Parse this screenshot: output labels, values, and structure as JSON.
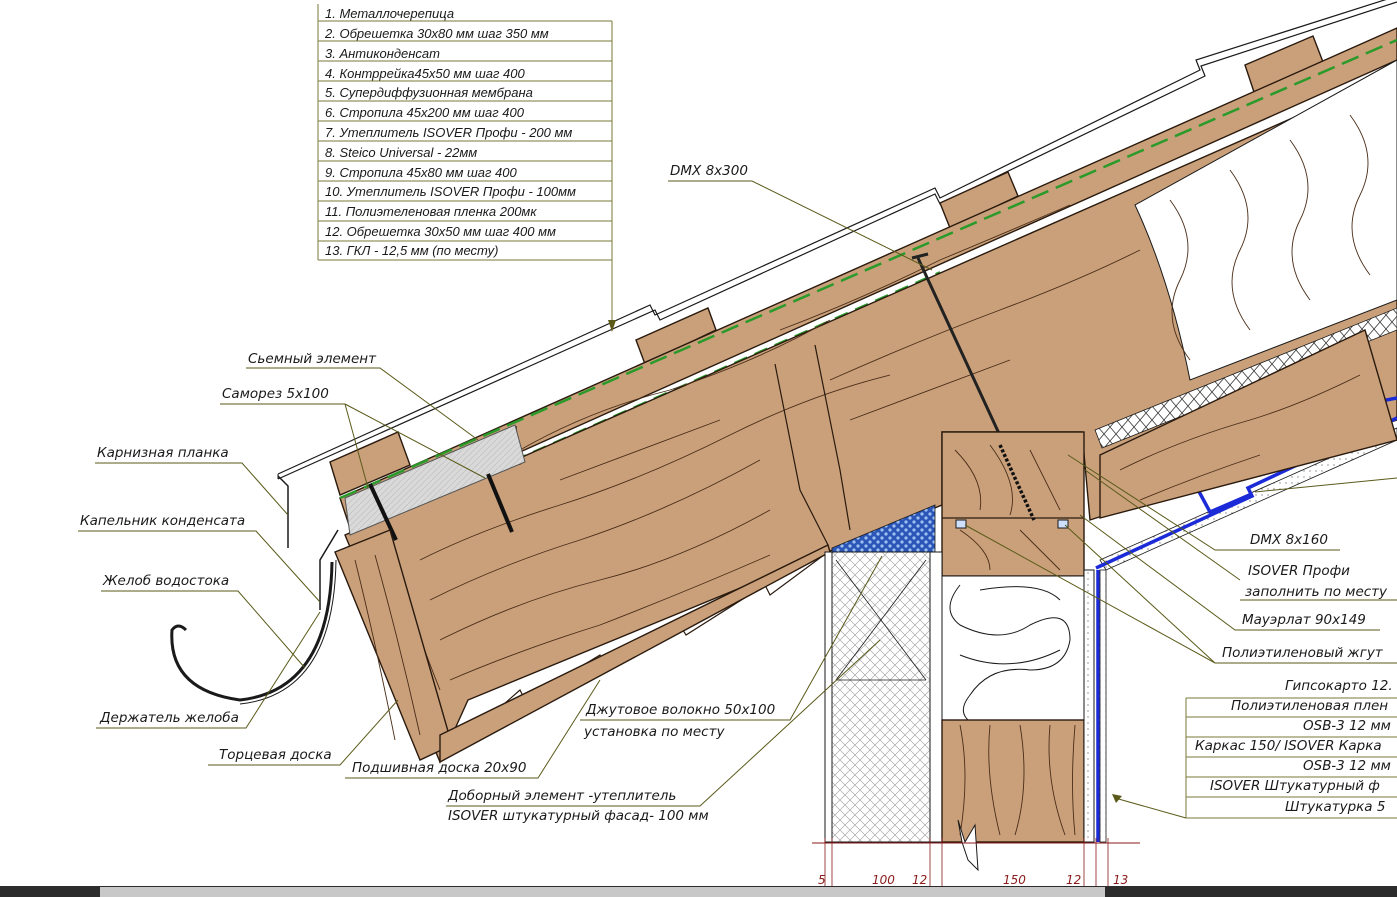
{
  "legend": {
    "items": [
      "1. Металлочерепица",
      "2. Обрешетка 30х80 мм шаг 350 мм",
      "3. Антиконденсат",
      "4. Контррейка45х50 мм шаг 400",
      "5. Супердиффузионная мембрана",
      "6. Стропила 45х200 мм шаг 400",
      "7. Утеплитель ISOVER Профи - 200 мм",
      "8. Steico Universal - 22мм",
      "9. Стропила 45х80 мм шаг 400",
      "10. Утеплитель ISOVER Профи - 100мм",
      "11. Полиэтеленовая пленка 200мк",
      "12. Обрешетка 30х50 мм шаг 400 мм",
      "13. ГКЛ - 12,5 мм (по месту)"
    ]
  },
  "callouts": {
    "dmx300": "DMX 8x300",
    "removable": "Сьемный элемент",
    "screw": "Саморез 5х100",
    "eaves_strip": "Карнизная планка",
    "drip": "Капельник конденсата",
    "gutter": "Желоб водостока",
    "gutter_holder": "Держатель желоба",
    "fascia": "Торцевая доска",
    "soffit": "Подшивная доска 20х90",
    "jute_1": "Джутовое волокно 50х100",
    "jute_2": "установка по месту",
    "extra_1": "Доборный элемент -утеплитель",
    "extra_2": "ISOVER штукатурный фасад- 100 мм",
    "dmx160": "DMX 8x160",
    "isover_1": "ISOVER Профи",
    "isover_2": "заполнить по месту",
    "mauerlat": "Мауэрлат 90х149",
    "pe_cord": "Полиэтиленовый жгут"
  },
  "wall_table": {
    "rows": [
      "Гипсокарто 12.",
      "Полиэтиленовая плен",
      "OSB-3 12 мм",
      "Каркас 150/ ISOVER Карка",
      "OSB-3 12 мм",
      "ISOVER Штукатурный ф",
      "Штукатурка 5"
    ]
  },
  "dimensions": [
    "5",
    "100",
    "12",
    "150",
    "12",
    "13"
  ],
  "colors": {
    "wood": "#c9a07a",
    "membrane": "#2a9a2a",
    "vapor_barrier": "#1c2bd8",
    "leader": "#5a5a1a",
    "dimension": "#8b1a1a",
    "insulation_blue": "#3a6ccc"
  }
}
